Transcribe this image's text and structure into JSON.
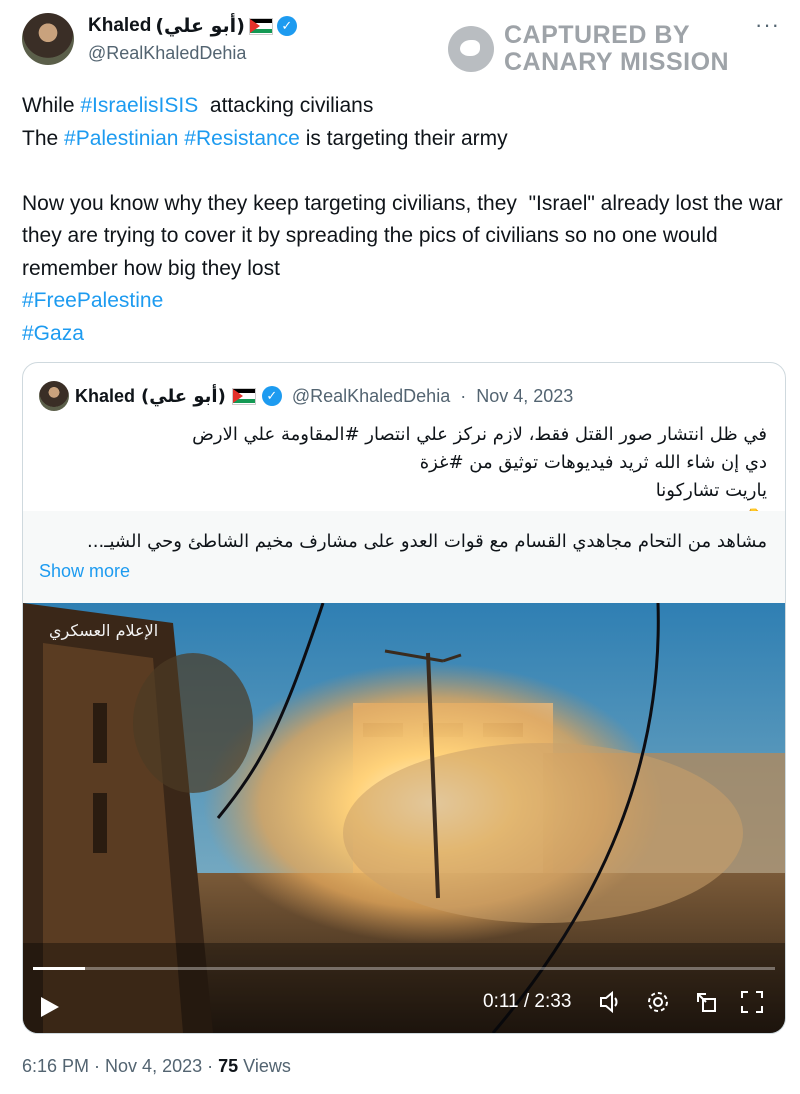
{
  "author": {
    "name": "Khaled",
    "name_arabic": "(أبو علي)",
    "handle": "@RealKhaledDehia"
  },
  "watermark": {
    "line1": "CAPTURED BY",
    "line2": "CANARY MISSION"
  },
  "menu_icon": "more-dots-icon",
  "tweet": {
    "l1_pre": "While ",
    "l1_tag": "#IsraelisISIS",
    "l1_post": "  attacking civilians",
    "l2_pre": "The ",
    "l2_tag1": "#Palestinian",
    "l2_mid": " ",
    "l2_tag2": "#Resistance",
    "l2_post": " is targeting their army",
    "l3": "Now you know why they keep targeting civilians, they  \"Israel\" already lost the war they are trying to cover it by spreading the pics of civilians so no one would remember how big they lost",
    "tag_free": "#FreePalestine",
    "tag_gaza": "#Gaza"
  },
  "quote": {
    "name": "Khaled",
    "name_arabic": "(أبو علي)",
    "handle": "@RealKhaledDehia",
    "sep": "·",
    "date": "Nov 4, 2023",
    "line1": "في ظل انتشار صور القتل فقط، لازم نركز علي انتصار #المقاومة علي الارض",
    "line2": "دي إن شاء الله ثريد فيديوهات توثيق من #غزة",
    "line3": "ياريت تشاركونا",
    "pointer": "👇",
    "card_text": "مشاهد من التحام مجاهدي القسام مع قوات العدو على مشارف مخيم الشاطئ وحي الشيـ...",
    "show_more": "Show more"
  },
  "video": {
    "overlay_logo": "الإعلام العسكري",
    "time": "0:11 / 2:33",
    "progress": 0.07
  },
  "footer": {
    "time": "6:16 PM",
    "dot": " · ",
    "date": "Nov 4, 2023",
    "views_count": "75",
    "views_label": " Views"
  },
  "colors": {
    "link": "#1d9bf0",
    "muted": "#536471",
    "text": "#0f1419"
  }
}
